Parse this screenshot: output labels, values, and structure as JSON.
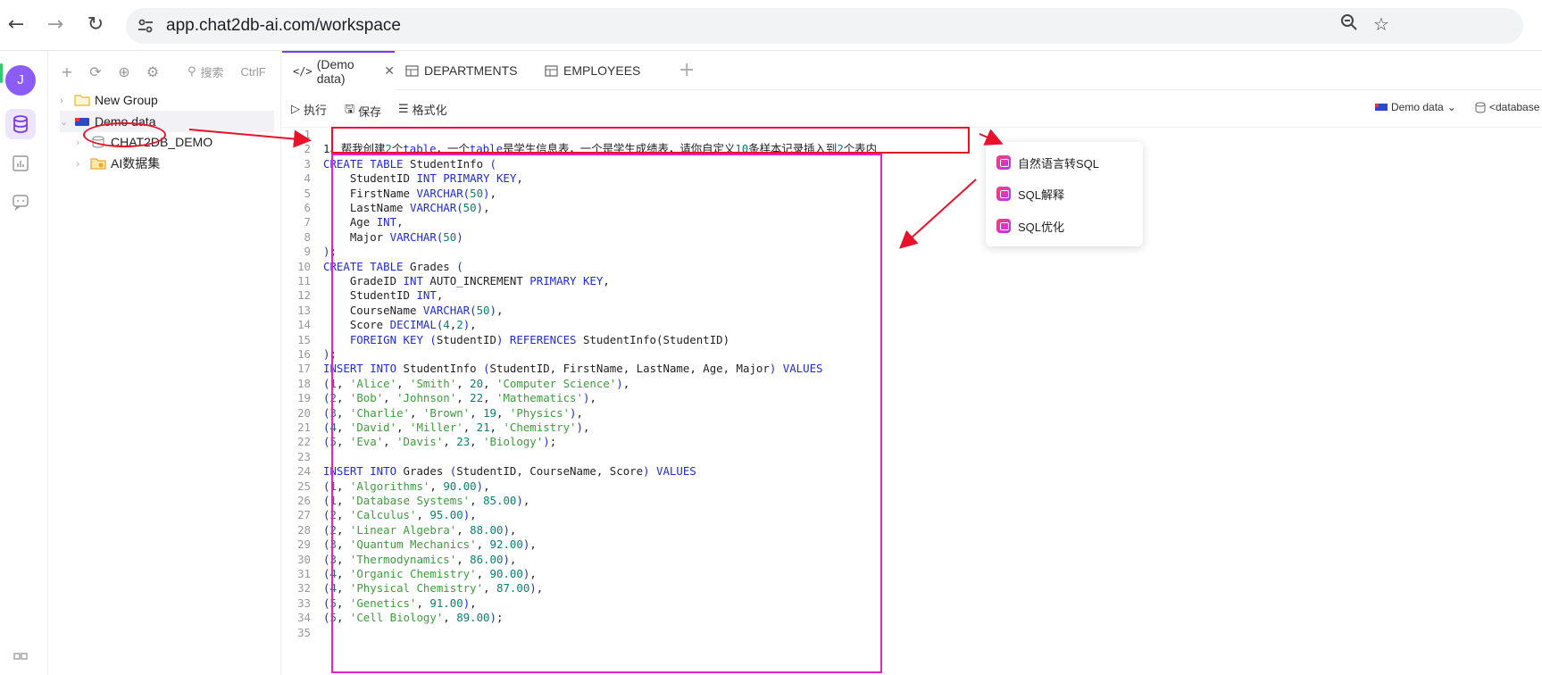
{
  "browser": {
    "url": "app.chat2db-ai.com/workspace"
  },
  "rail": {
    "avatar_letter": "J"
  },
  "tree": {
    "search_placeholder": "搜索",
    "search_shortcut": "CtrlF",
    "items": [
      {
        "label": "New Group"
      },
      {
        "label": "Demo data"
      },
      {
        "label": "CHAT2DB_DEMO"
      },
      {
        "label": "AI数据集"
      }
    ]
  },
  "tabs": [
    {
      "label": "(Demo data)"
    },
    {
      "label": "DEPARTMENTS"
    },
    {
      "label": "EMPLOYEES"
    }
  ],
  "toolbar": {
    "run": "执行",
    "save": "保存",
    "format": "格式化",
    "datasource": "Demo data",
    "database": "<database"
  },
  "popup": {
    "items": [
      {
        "label": "自然语言转SQL"
      },
      {
        "label": "SQL解释"
      },
      {
        "label": "SQL优化"
      }
    ]
  },
  "editor": {
    "lines": [
      [],
      [
        [
          "c",
          "1、帮我创建"
        ],
        [
          "n",
          "2"
        ],
        [
          "c",
          "个"
        ],
        [
          "k",
          "table"
        ],
        [
          "c",
          "，一个"
        ],
        [
          "k",
          "table"
        ],
        [
          "c",
          "是学生信息表，一个是学生成绩表，请你自定义"
        ],
        [
          "n",
          "10"
        ],
        [
          "c",
          "条样本记录插入到"
        ],
        [
          "n",
          "2"
        ],
        [
          "c",
          "个表内"
        ]
      ],
      [
        [
          "k",
          "CREATE TABLE "
        ],
        [
          "p",
          "StudentInfo "
        ],
        [
          "k",
          "("
        ]
      ],
      [
        [
          "p",
          "    StudentID "
        ],
        [
          "k",
          "INT PRIMARY KEY"
        ],
        [
          "p",
          ","
        ]
      ],
      [
        [
          "p",
          "    FirstName "
        ],
        [
          "k",
          "VARCHAR("
        ],
        [
          "n",
          "50"
        ],
        [
          "k",
          ")"
        ],
        [
          "p",
          ","
        ]
      ],
      [
        [
          "p",
          "    LastName "
        ],
        [
          "k",
          "VARCHAR("
        ],
        [
          "n",
          "50"
        ],
        [
          "k",
          ")"
        ],
        [
          "p",
          ","
        ]
      ],
      [
        [
          "p",
          "    Age "
        ],
        [
          "k",
          "INT"
        ],
        [
          "p",
          ","
        ]
      ],
      [
        [
          "p",
          "    Major "
        ],
        [
          "k",
          "VARCHAR("
        ],
        [
          "n",
          "50"
        ],
        [
          "k",
          ")"
        ]
      ],
      [
        [
          "k",
          ")"
        ],
        [
          "p",
          ";"
        ]
      ],
      [
        [
          "k",
          "CREATE TABLE "
        ],
        [
          "p",
          "Grades "
        ],
        [
          "k",
          "("
        ]
      ],
      [
        [
          "p",
          "    GradeID "
        ],
        [
          "k",
          "INT "
        ],
        [
          "p",
          "AUTO_INCREMENT "
        ],
        [
          "k",
          "PRIMARY KEY"
        ],
        [
          "p",
          ","
        ]
      ],
      [
        [
          "p",
          "    StudentID "
        ],
        [
          "k",
          "INT"
        ],
        [
          "p",
          ","
        ]
      ],
      [
        [
          "p",
          "    CourseName "
        ],
        [
          "k",
          "VARCHAR("
        ],
        [
          "n",
          "50"
        ],
        [
          "k",
          ")"
        ],
        [
          "p",
          ","
        ]
      ],
      [
        [
          "p",
          "    Score "
        ],
        [
          "k",
          "DECIMAL("
        ],
        [
          "n",
          "4"
        ],
        [
          "p",
          ","
        ],
        [
          "n",
          "2"
        ],
        [
          "k",
          ")"
        ],
        [
          "p",
          ","
        ]
      ],
      [
        [
          "p",
          "    "
        ],
        [
          "k",
          "FOREIGN KEY ("
        ],
        [
          "p",
          "StudentID"
        ],
        [
          "k",
          ") REFERENCES "
        ],
        [
          "p",
          "StudentInfo(StudentID)"
        ]
      ],
      [
        [
          "k",
          ")"
        ],
        [
          "p",
          ";"
        ]
      ],
      [
        [
          "k",
          "INSERT INTO "
        ],
        [
          "p",
          "StudentInfo "
        ],
        [
          "k",
          "("
        ],
        [
          "p",
          "StudentID, FirstName, LastName, Age, Major"
        ],
        [
          "k",
          ") VALUES"
        ]
      ],
      [
        [
          "k",
          "("
        ],
        [
          "n",
          "1"
        ],
        [
          "p",
          ", "
        ],
        [
          "s",
          "'Alice'"
        ],
        [
          "p",
          ", "
        ],
        [
          "s",
          "'Smith'"
        ],
        [
          "p",
          ", "
        ],
        [
          "n",
          "20"
        ],
        [
          "p",
          ", "
        ],
        [
          "s",
          "'Computer Science'"
        ],
        [
          "k",
          ")"
        ],
        [
          "p",
          ","
        ]
      ],
      [
        [
          "k",
          "("
        ],
        [
          "n",
          "2"
        ],
        [
          "p",
          ", "
        ],
        [
          "s",
          "'Bob'"
        ],
        [
          "p",
          ", "
        ],
        [
          "s",
          "'Johnson'"
        ],
        [
          "p",
          ", "
        ],
        [
          "n",
          "22"
        ],
        [
          "p",
          ", "
        ],
        [
          "s",
          "'Mathematics'"
        ],
        [
          "k",
          ")"
        ],
        [
          "p",
          ","
        ]
      ],
      [
        [
          "k",
          "("
        ],
        [
          "n",
          "3"
        ],
        [
          "p",
          ", "
        ],
        [
          "s",
          "'Charlie'"
        ],
        [
          "p",
          ", "
        ],
        [
          "s",
          "'Brown'"
        ],
        [
          "p",
          ", "
        ],
        [
          "n",
          "19"
        ],
        [
          "p",
          ", "
        ],
        [
          "s",
          "'Physics'"
        ],
        [
          "k",
          ")"
        ],
        [
          "p",
          ","
        ]
      ],
      [
        [
          "k",
          "("
        ],
        [
          "n",
          "4"
        ],
        [
          "p",
          ", "
        ],
        [
          "s",
          "'David'"
        ],
        [
          "p",
          ", "
        ],
        [
          "s",
          "'Miller'"
        ],
        [
          "p",
          ", "
        ],
        [
          "n",
          "21"
        ],
        [
          "p",
          ", "
        ],
        [
          "s",
          "'Chemistry'"
        ],
        [
          "k",
          ")"
        ],
        [
          "p",
          ","
        ]
      ],
      [
        [
          "k",
          "("
        ],
        [
          "n",
          "5"
        ],
        [
          "p",
          ", "
        ],
        [
          "s",
          "'Eva'"
        ],
        [
          "p",
          ", "
        ],
        [
          "s",
          "'Davis'"
        ],
        [
          "p",
          ", "
        ],
        [
          "n",
          "23"
        ],
        [
          "p",
          ", "
        ],
        [
          "s",
          "'Biology'"
        ],
        [
          "k",
          ")"
        ],
        [
          "p",
          ";"
        ]
      ],
      [],
      [
        [
          "k",
          "INSERT INTO "
        ],
        [
          "p",
          "Grades "
        ],
        [
          "k",
          "("
        ],
        [
          "p",
          "StudentID, CourseName, Score"
        ],
        [
          "k",
          ") VALUES"
        ]
      ],
      [
        [
          "k",
          "("
        ],
        [
          "n",
          "1"
        ],
        [
          "p",
          ", "
        ],
        [
          "s",
          "'Algorithms'"
        ],
        [
          "p",
          ", "
        ],
        [
          "n",
          "90.00"
        ],
        [
          "k",
          ")"
        ],
        [
          "p",
          ","
        ]
      ],
      [
        [
          "k",
          "("
        ],
        [
          "n",
          "1"
        ],
        [
          "p",
          ", "
        ],
        [
          "s",
          "'Database Systems'"
        ],
        [
          "p",
          ", "
        ],
        [
          "n",
          "85.00"
        ],
        [
          "k",
          ")"
        ],
        [
          "p",
          ","
        ]
      ],
      [
        [
          "k",
          "("
        ],
        [
          "n",
          "2"
        ],
        [
          "p",
          ", "
        ],
        [
          "s",
          "'Calculus'"
        ],
        [
          "p",
          ", "
        ],
        [
          "n",
          "95.00"
        ],
        [
          "k",
          ")"
        ],
        [
          "p",
          ","
        ]
      ],
      [
        [
          "k",
          "("
        ],
        [
          "n",
          "2"
        ],
        [
          "p",
          ", "
        ],
        [
          "s",
          "'Linear Algebra'"
        ],
        [
          "p",
          ", "
        ],
        [
          "n",
          "88.00"
        ],
        [
          "k",
          ")"
        ],
        [
          "p",
          ","
        ]
      ],
      [
        [
          "k",
          "("
        ],
        [
          "n",
          "3"
        ],
        [
          "p",
          ", "
        ],
        [
          "s",
          "'Quantum Mechanics'"
        ],
        [
          "p",
          ", "
        ],
        [
          "n",
          "92.00"
        ],
        [
          "k",
          ")"
        ],
        [
          "p",
          ","
        ]
      ],
      [
        [
          "k",
          "("
        ],
        [
          "n",
          "3"
        ],
        [
          "p",
          ", "
        ],
        [
          "s",
          "'Thermodynamics'"
        ],
        [
          "p",
          ", "
        ],
        [
          "n",
          "86.00"
        ],
        [
          "k",
          ")"
        ],
        [
          "p",
          ","
        ]
      ],
      [
        [
          "k",
          "("
        ],
        [
          "n",
          "4"
        ],
        [
          "p",
          ", "
        ],
        [
          "s",
          "'Organic Chemistry'"
        ],
        [
          "p",
          ", "
        ],
        [
          "n",
          "90.00"
        ],
        [
          "k",
          ")"
        ],
        [
          "p",
          ","
        ]
      ],
      [
        [
          "k",
          "("
        ],
        [
          "n",
          "4"
        ],
        [
          "p",
          ", "
        ],
        [
          "s",
          "'Physical Chemistry'"
        ],
        [
          "p",
          ", "
        ],
        [
          "n",
          "87.00"
        ],
        [
          "k",
          ")"
        ],
        [
          "p",
          ","
        ]
      ],
      [
        [
          "k",
          "("
        ],
        [
          "n",
          "5"
        ],
        [
          "p",
          ", "
        ],
        [
          "s",
          "'Genetics'"
        ],
        [
          "p",
          ", "
        ],
        [
          "n",
          "91.00"
        ],
        [
          "k",
          ")"
        ],
        [
          "p",
          ","
        ]
      ],
      [
        [
          "k",
          "("
        ],
        [
          "n",
          "5"
        ],
        [
          "p",
          ", "
        ],
        [
          "s",
          "'Cell Biology'"
        ],
        [
          "p",
          ", "
        ],
        [
          "n",
          "89.00"
        ],
        [
          "k",
          ")"
        ],
        [
          "p",
          ";"
        ]
      ],
      []
    ]
  },
  "colors": {
    "accent": "#7c3aed",
    "annotation_red": "#e8122a",
    "annotation_magenta": "#e820c8",
    "keyword": "#1f2bd8",
    "string": "#3e9c3e",
    "number": "#0a7f6f"
  }
}
